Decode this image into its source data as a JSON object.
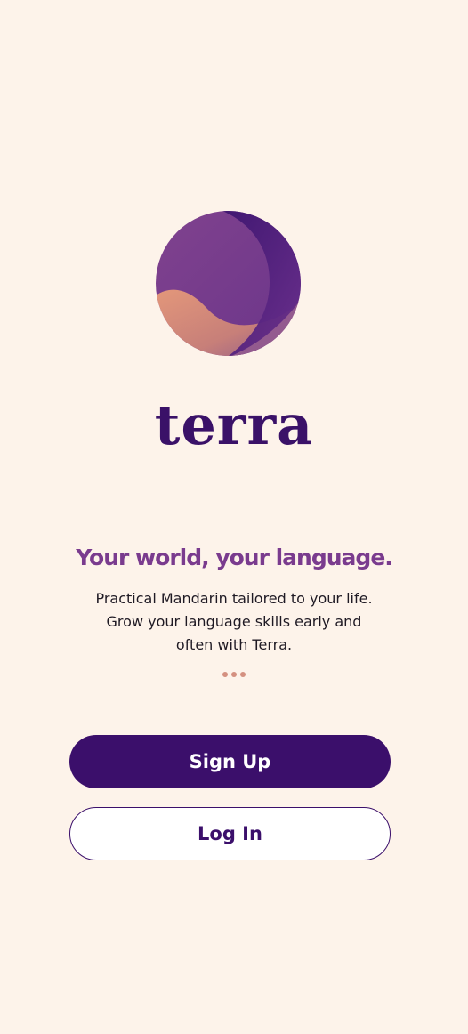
{
  "app": {
    "name": "terra",
    "headline": "Your world, your language.",
    "tagline_lines": [
      "Practical Mandarin tailored to your life.",
      "Grow your language skills early and",
      "often with Terra."
    ]
  },
  "carousel": {
    "indicator_count": 3
  },
  "actions": {
    "signup_label": "Sign Up",
    "login_label": "Log In"
  },
  "colors": {
    "background": "#fdf3ea",
    "brand_primary": "#3b0f6b",
    "headline": "#7a3b8e",
    "globe_purple": "#7b3f8c",
    "globe_peach": "#d88e74",
    "dot": "#d49080"
  },
  "icons": {
    "logo": "terra-globe-icon"
  }
}
